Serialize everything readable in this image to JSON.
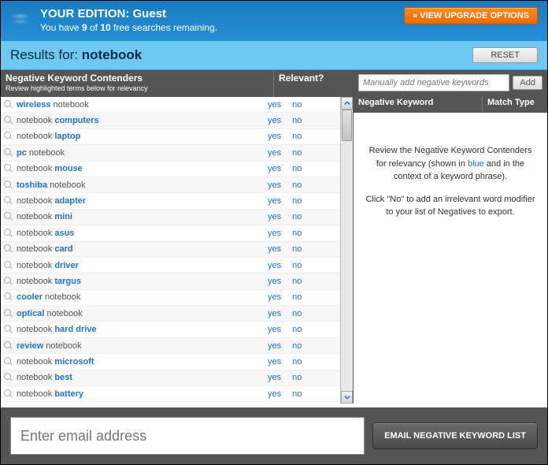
{
  "header": {
    "edition_prefix": "YOUR EDITION: ",
    "edition_name": "Guest",
    "sub_pre": "You have ",
    "sub_count": "9",
    "sub_mid": " of ",
    "sub_total": "10",
    "sub_post": " free searches remaining.",
    "upgrade_label": "» VIEW UPGRADE OPTIONS"
  },
  "results": {
    "prefix": "Results for: ",
    "term": "notebook",
    "reset_label": "RESET"
  },
  "left": {
    "th_contenders": "Negative Keyword Contenders",
    "th_sub": "Review highlighted terms below for relevancy",
    "th_relevant": "Relevant?",
    "yes": "yes",
    "no": "no",
    "rows": [
      {
        "parts": [
          {
            "t": "wireless",
            "hl": true
          },
          {
            "t": " notebook",
            "hl": false
          }
        ]
      },
      {
        "parts": [
          {
            "t": "notebook ",
            "hl": false
          },
          {
            "t": "computers",
            "hl": true
          }
        ]
      },
      {
        "parts": [
          {
            "t": "notebook ",
            "hl": false
          },
          {
            "t": "laptop",
            "hl": true
          }
        ]
      },
      {
        "parts": [
          {
            "t": "pc",
            "hl": true
          },
          {
            "t": " notebook",
            "hl": false
          }
        ]
      },
      {
        "parts": [
          {
            "t": "notebook ",
            "hl": false
          },
          {
            "t": "mouse",
            "hl": true
          }
        ]
      },
      {
        "parts": [
          {
            "t": "toshiba",
            "hl": true
          },
          {
            "t": " notebook",
            "hl": false
          }
        ]
      },
      {
        "parts": [
          {
            "t": "notebook ",
            "hl": false
          },
          {
            "t": "adapter",
            "hl": true
          }
        ]
      },
      {
        "parts": [
          {
            "t": "notebook ",
            "hl": false
          },
          {
            "t": "mini",
            "hl": true
          }
        ]
      },
      {
        "parts": [
          {
            "t": "notebook ",
            "hl": false
          },
          {
            "t": "asus",
            "hl": true
          }
        ]
      },
      {
        "parts": [
          {
            "t": "notebook ",
            "hl": false
          },
          {
            "t": "card",
            "hl": true
          }
        ]
      },
      {
        "parts": [
          {
            "t": "notebook ",
            "hl": false
          },
          {
            "t": "driver",
            "hl": true
          }
        ]
      },
      {
        "parts": [
          {
            "t": "notebook ",
            "hl": false
          },
          {
            "t": "targus",
            "hl": true
          }
        ]
      },
      {
        "parts": [
          {
            "t": "cooler",
            "hl": true
          },
          {
            "t": " notebook",
            "hl": false
          }
        ]
      },
      {
        "parts": [
          {
            "t": "optical",
            "hl": true
          },
          {
            "t": " notebook",
            "hl": false
          }
        ]
      },
      {
        "parts": [
          {
            "t": "notebook ",
            "hl": false
          },
          {
            "t": "hard drive",
            "hl": true
          }
        ]
      },
      {
        "parts": [
          {
            "t": "review",
            "hl": true
          },
          {
            "t": " notebook",
            "hl": false
          }
        ]
      },
      {
        "parts": [
          {
            "t": "notebook ",
            "hl": false
          },
          {
            "t": "microsoft",
            "hl": true
          }
        ]
      },
      {
        "parts": [
          {
            "t": "notebook ",
            "hl": false
          },
          {
            "t": "best",
            "hl": true
          }
        ]
      },
      {
        "parts": [
          {
            "t": "notebook ",
            "hl": false
          },
          {
            "t": "battery",
            "hl": true
          }
        ]
      }
    ]
  },
  "right": {
    "add_placeholder": "Manually add negative keywords",
    "add_label": "Add",
    "th_nk": "Negative Keyword",
    "th_mt": "Match Type",
    "body_p1_pre": "Review the Negative Keyword Contenders for relevancy (shown in ",
    "body_p1_blue": "blue",
    "body_p1_post": " and in the context of a keyword phrase).",
    "body_p2": "Click \"No\" to add an irrelevant word modifier to your list of Negatives to export."
  },
  "footer": {
    "email_placeholder": "Enter email address",
    "email_btn": "EMAIL NEGATIVE KEYWORD LIST"
  }
}
